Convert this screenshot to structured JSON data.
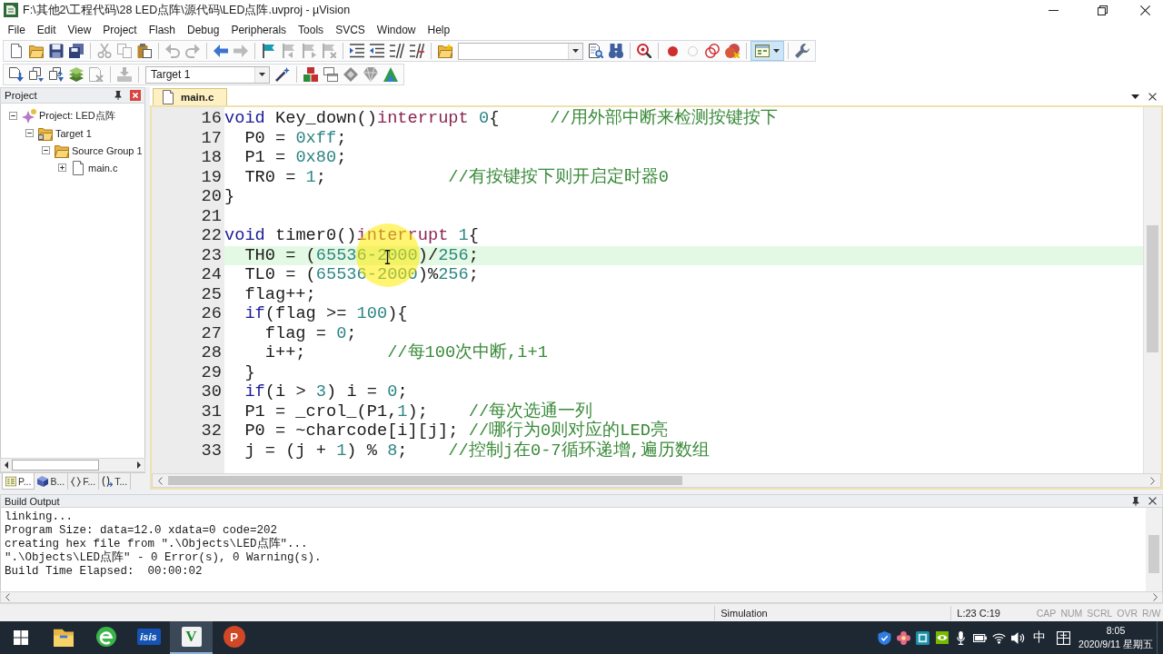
{
  "window": {
    "title": "F:\\其他2\\工程代码\\28 LED点阵\\源代码\\LED点阵.uvproj - µVision"
  },
  "menu": [
    "File",
    "Edit",
    "View",
    "Project",
    "Flash",
    "Debug",
    "Peripherals",
    "Tools",
    "SVCS",
    "Window",
    "Help"
  ],
  "toolbars": [
    {
      "items": [
        {
          "kind": "new",
          "disabled": false
        },
        {
          "kind": "open",
          "disabled": false
        },
        {
          "kind": "save",
          "disabled": false
        },
        {
          "kind": "save_all",
          "disabled": false
        },
        {
          "kind": "separator"
        },
        {
          "kind": "cut",
          "disabled": true
        },
        {
          "kind": "copy",
          "disabled": true
        },
        {
          "kind": "paste",
          "disabled": false
        },
        {
          "kind": "separator"
        },
        {
          "kind": "undo",
          "disabled": true
        },
        {
          "kind": "redo",
          "disabled": true
        },
        {
          "kind": "separator"
        },
        {
          "kind": "back",
          "disabled": false
        },
        {
          "kind": "forward",
          "disabled": true
        },
        {
          "kind": "separator"
        },
        {
          "kind": "bookmark",
          "disabled": false
        },
        {
          "kind": "bookmark_prev",
          "disabled": true
        },
        {
          "kind": "bookmark_next",
          "disabled": true
        },
        {
          "kind": "bookmark_clear",
          "disabled": true
        },
        {
          "kind": "separator"
        },
        {
          "kind": "indent",
          "disabled": false
        },
        {
          "kind": "unindent",
          "disabled": false
        },
        {
          "kind": "comment",
          "disabled": false
        },
        {
          "kind": "uncomment",
          "disabled": false
        },
        {
          "kind": "separator"
        },
        {
          "kind": "find_in_files",
          "disabled": false
        },
        {
          "kind": "combo"
        },
        {
          "kind": "find",
          "disabled": false
        },
        {
          "kind": "incremental_find",
          "disabled": false
        },
        {
          "kind": "separator"
        },
        {
          "kind": "debug",
          "disabled": false
        },
        {
          "kind": "separator"
        },
        {
          "kind": "breakpoint",
          "disabled": false
        },
        {
          "kind": "breakpoint_enable",
          "disabled": true
        },
        {
          "kind": "breakpoint_disable_all",
          "disabled": false
        },
        {
          "kind": "breakpoint_kill_all",
          "disabled": false
        },
        {
          "kind": "separator"
        },
        {
          "kind": "windows",
          "disabled": false,
          "pressed": true
        },
        {
          "kind": "separator"
        },
        {
          "kind": "configure",
          "disabled": false
        }
      ]
    },
    {
      "items": [
        {
          "kind": "translate",
          "disabled": false
        },
        {
          "kind": "build",
          "disabled": false
        },
        {
          "kind": "rebuild",
          "disabled": false
        },
        {
          "kind": "batch_build",
          "disabled": false
        },
        {
          "kind": "stop_build",
          "disabled": true
        },
        {
          "kind": "separator"
        },
        {
          "kind": "download",
          "disabled": true
        },
        {
          "kind": "separator"
        },
        {
          "kind": "combo",
          "value": "Target 1"
        },
        {
          "kind": "target_options",
          "disabled": false
        },
        {
          "kind": "separator"
        },
        {
          "kind": "components",
          "disabled": false
        },
        {
          "kind": "project_items",
          "disabled": false
        },
        {
          "kind": "packs",
          "disabled": false
        },
        {
          "kind": "pack_installer",
          "disabled": false
        },
        {
          "kind": "environment",
          "disabled": false
        }
      ]
    }
  ],
  "project": {
    "title": "Project",
    "tree": [
      {
        "kind": "project",
        "label": "Project: LED点阵",
        "expanded": true,
        "children": [
          {
            "kind": "target",
            "label": "Target 1",
            "expanded": true,
            "children": [
              {
                "kind": "group",
                "label": "Source Group 1",
                "expanded": true,
                "children": [
                  {
                    "kind": "file",
                    "label": "main.c",
                    "expanded": false
                  }
                ]
              }
            ]
          }
        ]
      }
    ],
    "tabs": [
      {
        "kind": "project",
        "label": "P...",
        "selected": true
      },
      {
        "kind": "books",
        "label": "B...",
        "selected": false
      },
      {
        "kind": "functions",
        "label": "F...",
        "selected": false
      },
      {
        "kind": "templates",
        "label": "T...",
        "selected": false
      }
    ]
  },
  "editor": {
    "tabs": [
      {
        "label": "main.c",
        "selected": true
      }
    ],
    "lines": [
      {
        "number": "16",
        "current": false,
        "tokens": [
          {
            "kind": "keyword",
            "text": "void"
          },
          {
            "kind": "plain",
            "text": " Key_down()"
          },
          {
            "kind": "keyword2",
            "text": "interrupt"
          },
          {
            "kind": "number",
            "text": " 0"
          },
          {
            "kind": "plain",
            "text": "{     "
          },
          {
            "kind": "comment",
            "text": "//用外部中断来检测按键按下"
          }
        ]
      },
      {
        "number": "17",
        "current": false,
        "tokens": [
          {
            "kind": "plain",
            "text": "  P0 = "
          },
          {
            "kind": "number",
            "text": "0xff"
          },
          {
            "kind": "plain",
            "text": ";"
          }
        ]
      },
      {
        "number": "18",
        "current": false,
        "tokens": [
          {
            "kind": "plain",
            "text": "  P1 = "
          },
          {
            "kind": "number",
            "text": "0x80"
          },
          {
            "kind": "plain",
            "text": ";"
          }
        ]
      },
      {
        "number": "19",
        "current": false,
        "tokens": [
          {
            "kind": "plain",
            "text": "  TR0 = "
          },
          {
            "kind": "number",
            "text": "1"
          },
          {
            "kind": "plain",
            "text": ";            "
          },
          {
            "kind": "comment",
            "text": "//有按键按下则开启定时器0"
          }
        ]
      },
      {
        "number": "20",
        "current": false,
        "tokens": [
          {
            "kind": "plain",
            "text": "}"
          }
        ]
      },
      {
        "number": "21",
        "current": false
      },
      {
        "number": "22",
        "current": false,
        "tokens": [
          {
            "kind": "keyword",
            "text": "void"
          },
          {
            "kind": "plain",
            "text": " timer0()"
          },
          {
            "kind": "keyword2",
            "text": "interrupt"
          },
          {
            "kind": "number",
            "text": " 1"
          },
          {
            "kind": "plain",
            "text": "{"
          }
        ]
      },
      {
        "number": "23",
        "current": true,
        "tokens": [
          {
            "kind": "plain",
            "text": "  TH0 = ("
          },
          {
            "kind": "number",
            "text": "65536-2000"
          },
          {
            "kind": "plain",
            "text": ")/"
          },
          {
            "kind": "number",
            "text": "256"
          },
          {
            "kind": "plain",
            "text": ";"
          }
        ]
      },
      {
        "number": "24",
        "current": false,
        "tokens": [
          {
            "kind": "plain",
            "text": "  TL0 = ("
          },
          {
            "kind": "number",
            "text": "65536-2000"
          },
          {
            "kind": "plain",
            "text": ")%"
          },
          {
            "kind": "number",
            "text": "256"
          },
          {
            "kind": "plain",
            "text": ";"
          }
        ]
      },
      {
        "number": "25",
        "current": false,
        "tokens": [
          {
            "kind": "plain",
            "text": "  flag++;"
          }
        ]
      },
      {
        "number": "26",
        "current": false,
        "tokens": [
          {
            "kind": "keyword",
            "text": "  if"
          },
          {
            "kind": "plain",
            "text": "(flag >= "
          },
          {
            "kind": "number",
            "text": "100"
          },
          {
            "kind": "plain",
            "text": "){"
          }
        ]
      },
      {
        "number": "27",
        "current": false,
        "tokens": [
          {
            "kind": "plain",
            "text": "    flag = "
          },
          {
            "kind": "number",
            "text": "0"
          },
          {
            "kind": "plain",
            "text": ";"
          }
        ]
      },
      {
        "number": "28",
        "current": false,
        "tokens": [
          {
            "kind": "plain",
            "text": "    i++;        "
          },
          {
            "kind": "comment",
            "text": "//每100次中断,i+1"
          }
        ]
      },
      {
        "number": "29",
        "current": false,
        "tokens": [
          {
            "kind": "plain",
            "text": "  }"
          }
        ]
      },
      {
        "number": "30",
        "current": false,
        "tokens": [
          {
            "kind": "keyword",
            "text": "  if"
          },
          {
            "kind": "plain",
            "text": "(i > "
          },
          {
            "kind": "number",
            "text": "3"
          },
          {
            "kind": "plain",
            "text": ") i = "
          },
          {
            "kind": "number",
            "text": "0"
          },
          {
            "kind": "plain",
            "text": ";"
          }
        ]
      },
      {
        "number": "31",
        "current": false,
        "tokens": [
          {
            "kind": "plain",
            "text": "  P1 = _crol_(P1,"
          },
          {
            "kind": "number",
            "text": "1"
          },
          {
            "kind": "plain",
            "text": ");    "
          },
          {
            "kind": "comment",
            "text": "//每次选通一列"
          }
        ]
      },
      {
        "number": "32",
        "current": false,
        "tokens": [
          {
            "kind": "plain",
            "text": "  P0 = ~charcode[i][j]; "
          },
          {
            "kind": "comment",
            "text": "//哪行为0则对应的LED亮"
          }
        ]
      },
      {
        "number": "33",
        "current": false,
        "tokens": [
          {
            "kind": "plain",
            "text": "  j = (j + "
          },
          {
            "kind": "number",
            "text": "1"
          },
          {
            "kind": "plain",
            "text": ") % "
          },
          {
            "kind": "number",
            "text": "8"
          },
          {
            "kind": "plain",
            "text": ";    "
          },
          {
            "kind": "comment",
            "text": "//控制j在0-7循环递增,遍历数组"
          }
        ]
      }
    ]
  },
  "build_output": {
    "title": "Build Output",
    "lines": [
      "linking...",
      "Program Size: data=12.0 xdata=0 code=202",
      "creating hex file from \".\\Objects\\LED点阵\"...",
      "\".\\Objects\\LED点阵\" - 0 Error(s), 0 Warning(s).",
      "Build Time Elapsed:  00:00:02"
    ]
  },
  "status_bar": {
    "mode": "Simulation",
    "position": "L:23 C:19",
    "indicators": [
      {
        "label": "CAP",
        "on": false
      },
      {
        "label": "NUM",
        "on": false
      },
      {
        "label": "SCRL",
        "on": false
      },
      {
        "label": "OVR",
        "on": false
      },
      {
        "label": "R/W",
        "on": false
      }
    ]
  },
  "taskbar": {
    "apps": [
      {
        "kind": "explorer",
        "selected": false
      },
      {
        "kind": "browser",
        "selected": false
      },
      {
        "kind": "isis",
        "label": "isis",
        "selected": false
      },
      {
        "kind": "keil",
        "label": "V",
        "selected": true
      },
      {
        "kind": "powerpoint",
        "label": "P",
        "selected": false
      }
    ],
    "tray": {
      "icons": [
        {
          "kind": "shield"
        },
        {
          "kind": "flower"
        },
        {
          "kind": "app_tile"
        },
        {
          "kind": "nvidia"
        },
        {
          "kind": "microphone"
        },
        {
          "kind": "battery"
        },
        {
          "kind": "wifi"
        },
        {
          "kind": "volume"
        }
      ],
      "ime": "中",
      "time": "8:05",
      "date": "2020/9/11 星期五"
    }
  }
}
